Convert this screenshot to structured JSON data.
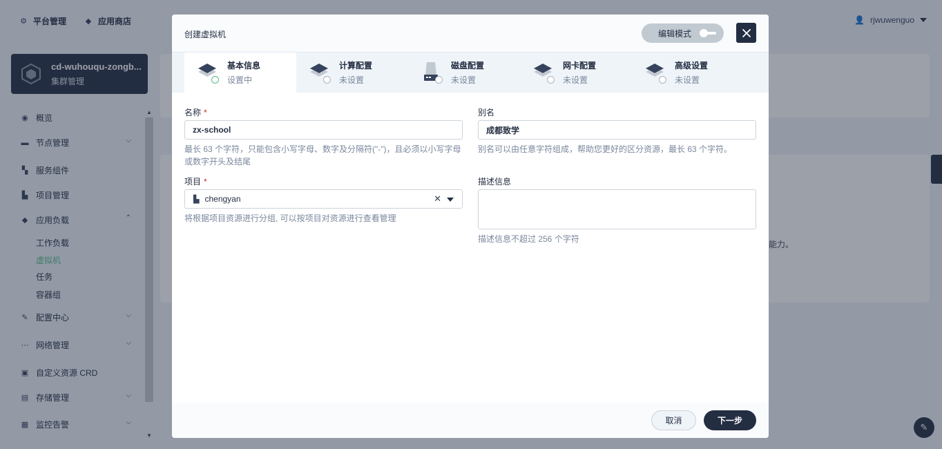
{
  "topnav": {
    "platform": "平台管理",
    "appstore": "应用商店"
  },
  "user": {
    "name": "rjwuwenguo"
  },
  "cluster": {
    "name": "cd-wuhouqu-zongb...",
    "subtitle": "集群管理"
  },
  "sidebar": {
    "items": [
      {
        "label": "概览",
        "icon": "dashboard-icon"
      },
      {
        "label": "节点管理",
        "icon": "nodes-icon"
      },
      {
        "label": "服务组件",
        "icon": "components-icon"
      },
      {
        "label": "项目管理",
        "icon": "project-icon"
      },
      {
        "label": "应用负载",
        "icon": "workload-icon"
      },
      {
        "label": "配置中心",
        "icon": "config-icon"
      },
      {
        "label": "网络管理",
        "icon": "network-icon"
      },
      {
        "label": "自定义资源 CRD",
        "icon": "crd-icon"
      },
      {
        "label": "存储管理",
        "icon": "storage-icon"
      },
      {
        "label": "监控告警",
        "icon": "monitor-icon"
      }
    ],
    "sub_items": [
      "工作负载",
      "虚拟机",
      "任务",
      "容器组"
    ],
    "active_sub": "虚拟机"
  },
  "background": {
    "cut_text": "能力。"
  },
  "modal": {
    "title": "创建虚拟机",
    "edit_mode_label": "编辑模式",
    "steps": [
      {
        "title": "基本信息",
        "status": "设置中",
        "icon": "layers-icon"
      },
      {
        "title": "计算配置",
        "status": "未设置",
        "icon": "layers-icon"
      },
      {
        "title": "磁盘配置",
        "status": "未设置",
        "icon": "disk-icon"
      },
      {
        "title": "网卡配置",
        "status": "未设置",
        "icon": "layers-icon"
      },
      {
        "title": "高级设置",
        "status": "未设置",
        "icon": "layers-icon"
      }
    ],
    "form": {
      "name": {
        "label": "名称",
        "required_mark": "*",
        "value": "zx-school",
        "description": "最长 63 个字符，只能包含小写字母、数字及分隔符(\"-\")，且必须以小写字母或数字开头及结尾"
      },
      "alias": {
        "label": "别名",
        "value": "成都致学",
        "description": "别名可以由任意字符组成，帮助您更好的区分资源，最长 63 个字符。"
      },
      "project": {
        "label": "项目",
        "required_mark": "*",
        "value": "chengyan",
        "description": "将根据项目资源进行分组, 可以按项目对资源进行查看管理"
      },
      "description": {
        "label": "描述信息",
        "value": "",
        "description": "描述信息不超过 256 个字符"
      }
    },
    "footer": {
      "cancel": "取消",
      "next": "下一步"
    }
  },
  "colors": {
    "primary_dark": "#242e42",
    "success": "#55bc8a",
    "required": "#ca2621"
  }
}
